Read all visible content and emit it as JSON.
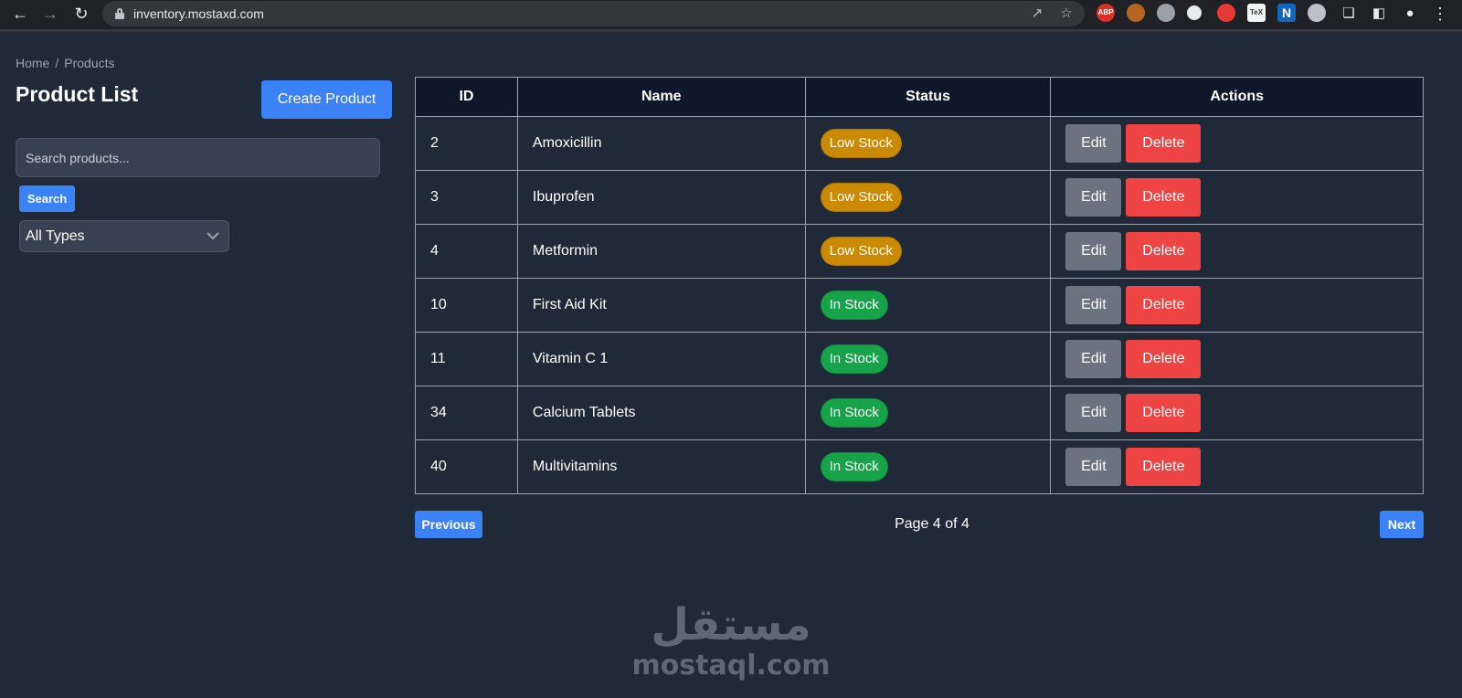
{
  "browser": {
    "url": "inventory.mostaxd.com",
    "extensions": [
      "ABP",
      "cookie",
      "globe",
      "circle",
      "shield",
      "TeX",
      "N",
      "badge",
      "puzzle",
      "sidebar",
      "profile",
      "menu"
    ]
  },
  "breadcrumb": {
    "home": "Home",
    "separator": "/",
    "current": "Products"
  },
  "page_title": "Product List",
  "create_button": "Create Product",
  "search": {
    "placeholder": "Search products...",
    "button": "Search"
  },
  "type_filter": {
    "selected": "All Types"
  },
  "table": {
    "headers": [
      "ID",
      "Name",
      "Status",
      "Actions"
    ],
    "edit_label": "Edit",
    "delete_label": "Delete",
    "rows": [
      {
        "id": "2",
        "name": "Amoxicillin",
        "status": "Low Stock",
        "status_type": "low"
      },
      {
        "id": "3",
        "name": "Ibuprofen",
        "status": "Low Stock",
        "status_type": "low"
      },
      {
        "id": "4",
        "name": "Metformin",
        "status": "Low Stock",
        "status_type": "low"
      },
      {
        "id": "10",
        "name": "First Aid Kit",
        "status": "In Stock",
        "status_type": "in"
      },
      {
        "id": "11",
        "name": "Vitamin C 1",
        "status": "In Stock",
        "status_type": "in"
      },
      {
        "id": "34",
        "name": "Calcium Tablets",
        "status": "In Stock",
        "status_type": "in"
      },
      {
        "id": "40",
        "name": "Multivitamins",
        "status": "In Stock",
        "status_type": "in"
      }
    ]
  },
  "pagination": {
    "previous": "Previous",
    "info": "Page 4 of 4",
    "next": "Next"
  },
  "watermark": {
    "arabic": "مستقل",
    "latin": "mostaql.com"
  },
  "colors": {
    "background": "#1f2937",
    "primary": "#3b82f6",
    "danger": "#ef4444",
    "secondary": "#6b7280",
    "low_stock": "#ca8a04",
    "in_stock": "#16a34a"
  }
}
